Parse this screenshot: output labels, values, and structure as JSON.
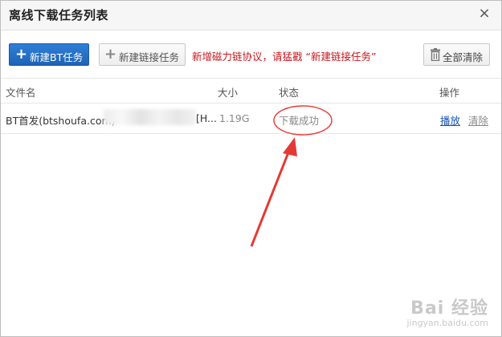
{
  "dialog": {
    "title": "离线下载任务列表",
    "close_symbol": "×"
  },
  "toolbar": {
    "new_bt_label": "新建BT任务",
    "new_link_label": "新建链接任务",
    "notice": "新增磁力链协议，请猛戳 “新建链接任务”",
    "clear_all_label": "全部清除",
    "plus_symbol": "+"
  },
  "table": {
    "columns": {
      "filename": "文件名",
      "size": "大小",
      "status": "状态",
      "actions": "操作"
    },
    "rows": [
      {
        "filename_start": "BT首发(btshoufa.com)",
        "filename_end": "[H...",
        "size": "1.19G",
        "status": "下载成功",
        "play_label": "播放",
        "delete_label": "清除"
      }
    ]
  },
  "watermark": {
    "brand": "Bai 经验",
    "url": "jingyan.baidu.com"
  },
  "colors": {
    "primary_button": "#1d63b7",
    "notice_red": "#c8161d",
    "annotation_red": "#e53935",
    "link_blue": "#1a56b4"
  }
}
